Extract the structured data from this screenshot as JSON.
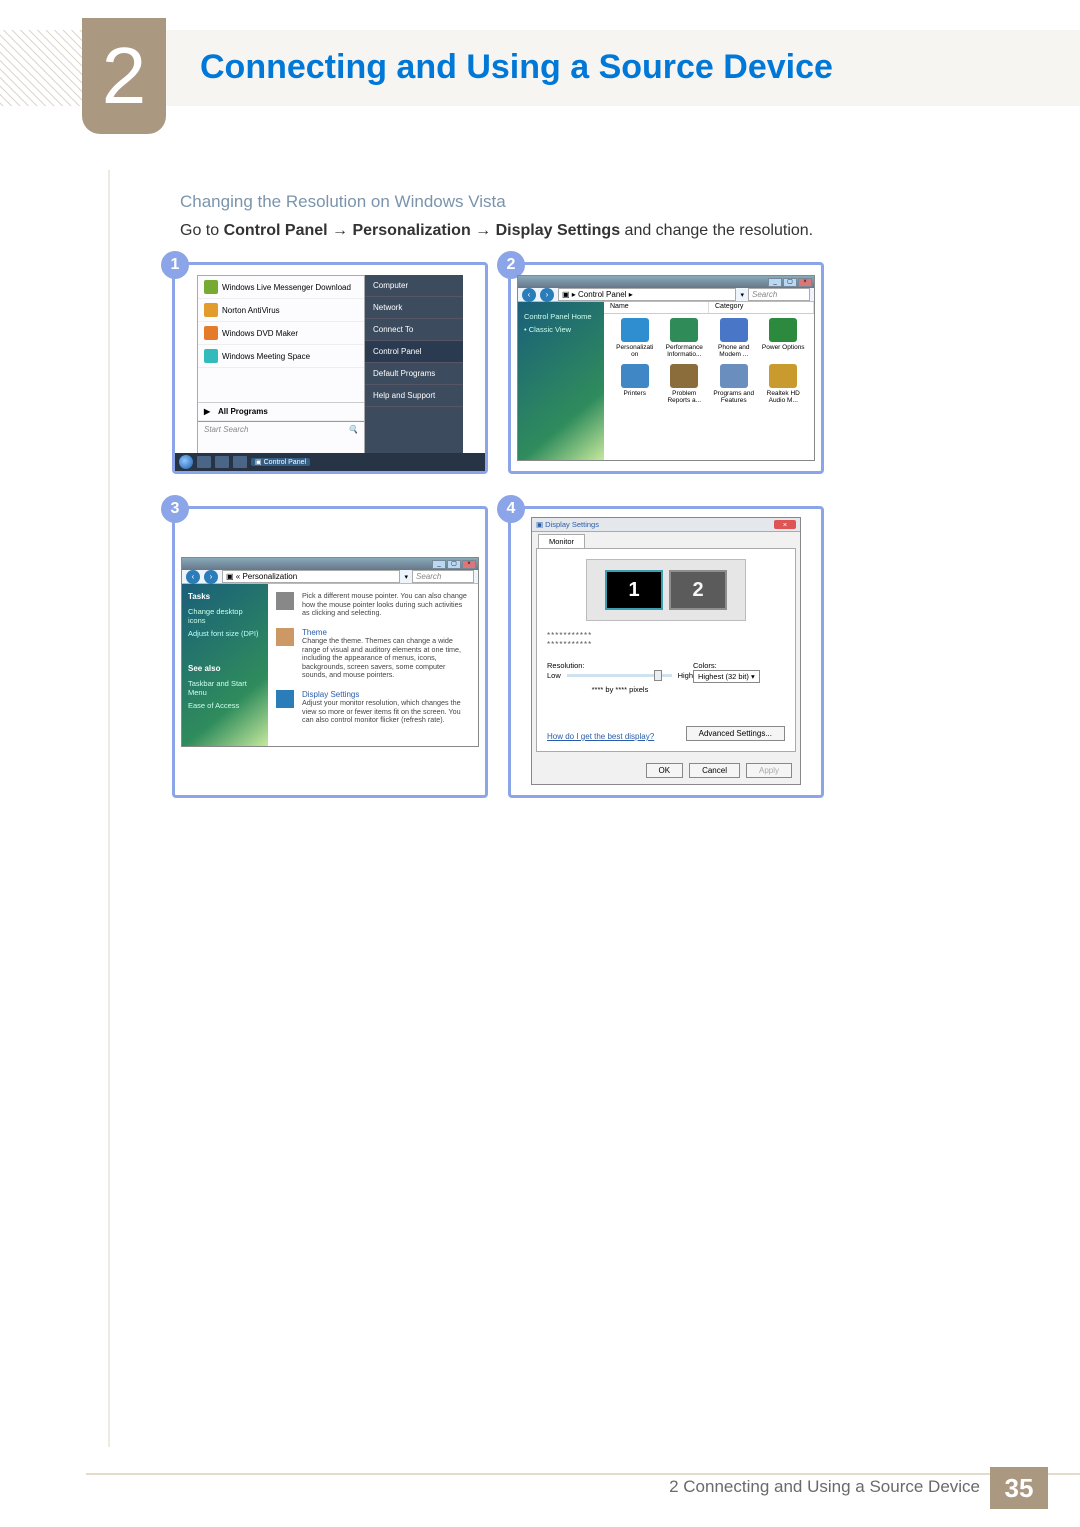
{
  "chapter_number": "2",
  "chapter_title": "Connecting and Using a Source Device",
  "section_title": "Changing the Resolution on Windows Vista",
  "instruction_prefix": "Go to ",
  "instruction_path": "Control Panel → Personalization → Display Settings",
  "instruction_suffix": " and change the resolution.",
  "badges": {
    "1": "1",
    "2": "2",
    "3": "3",
    "4": "4"
  },
  "panel1": {
    "start_items": [
      "Windows Live Messenger Download",
      "Norton AntiVirus",
      "Windows DVD Maker",
      "Windows Meeting Space"
    ],
    "all_programs": "All Programs",
    "search_placeholder": "Start Search",
    "right_items": [
      "Computer",
      "Network",
      "Connect To",
      "Control Panel",
      "Default Programs",
      "Help and Support"
    ],
    "taskbar_label": "Control Panel"
  },
  "panel2": {
    "breadcrumb": "Control Panel  ▸",
    "search": "Search",
    "side_home": "Control Panel Home",
    "side_classic": "Classic View",
    "cols": {
      "name": "Name",
      "category": "Category"
    },
    "items": [
      {
        "label": "Personalizati on",
        "color": "#2f8ecf"
      },
      {
        "label": "Performance Informatio...",
        "color": "#2f8b57"
      },
      {
        "label": "Phone and Modem ...",
        "color": "#4a76c7"
      },
      {
        "label": "Power Options",
        "color": "#2c8a3f"
      },
      {
        "label": "Printers",
        "color": "#3f88c5"
      },
      {
        "label": "Problem Reports a...",
        "color": "#8a6d3b"
      },
      {
        "label": "Programs and Features",
        "color": "#6a8fbf"
      },
      {
        "label": "Realtek HD Audio M...",
        "color": "#c99b2e"
      }
    ]
  },
  "panel3": {
    "breadcrumb": "« Personalization",
    "search": "Search",
    "tasks_hdr": "Tasks",
    "tasks": [
      "Change desktop icons",
      "Adjust font size (DPI)"
    ],
    "see_also_hdr": "See also",
    "see_also": [
      "Taskbar and Start Menu",
      "Ease of Access"
    ],
    "blocks": [
      {
        "title": "",
        "text": "Pick a different mouse pointer. You can also change how the mouse pointer looks during such activities as clicking and selecting."
      },
      {
        "title": "Theme",
        "text": "Change the theme. Themes can change a wide range of visual and auditory elements at one time, including the appearance of menus, icons, backgrounds, screen savers, some computer sounds, and mouse pointers."
      },
      {
        "title": "Display Settings",
        "text": "Adjust your monitor resolution, which changes the view so more or fewer items fit on the screen. You can also control monitor flicker (refresh rate)."
      }
    ]
  },
  "panel4": {
    "title": "Display Settings",
    "tab": "Monitor",
    "monitors": [
      "1",
      "2"
    ],
    "stars1": "***********",
    "stars2": "***********",
    "resolution_label": "Resolution:",
    "low": "Low",
    "high": "High",
    "res_text": "**** by **** pixels",
    "colors_label": "Colors:",
    "colors_value": "Highest (32 bit)",
    "link": "How do I get the best display?",
    "adv": "Advanced Settings...",
    "ok": "OK",
    "cancel": "Cancel",
    "apply": "Apply"
  },
  "footer": {
    "chapter": "2 Connecting and Using a Source Device",
    "page": "35"
  }
}
